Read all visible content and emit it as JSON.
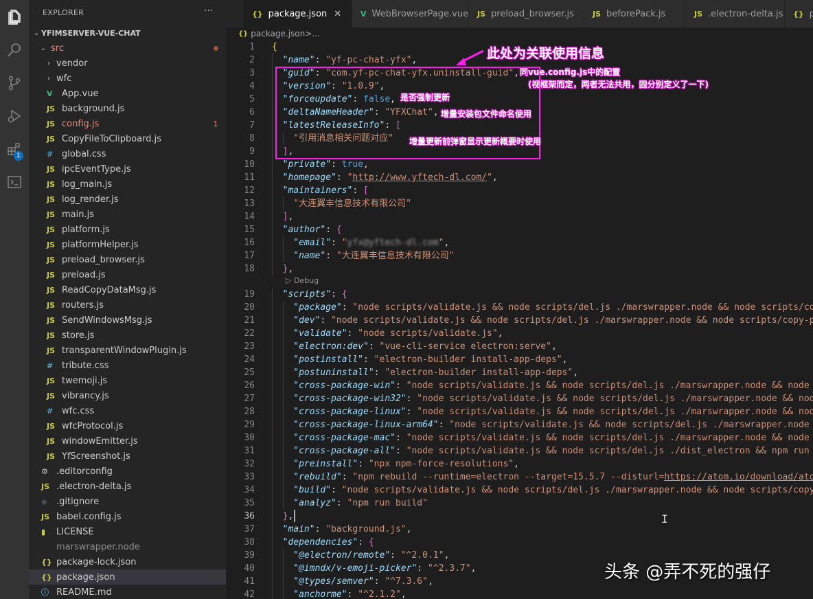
{
  "activity_bar": {
    "extensions_badge": "1"
  },
  "explorer": {
    "title": "EXPLORER",
    "more": "···",
    "root_folder": "YFIMSERVER-VUE-CHAT",
    "items": [
      {
        "name": "src",
        "kind": "folder-open",
        "indent": 1,
        "icon": "",
        "color": "#f48771",
        "dot": true
      },
      {
        "name": "vendor",
        "kind": "folder",
        "indent": 2,
        "icon": "",
        "color": "#cccccc"
      },
      {
        "name": "wfc",
        "kind": "folder",
        "indent": 2,
        "icon": "",
        "color": "#cccccc"
      },
      {
        "name": "App.vue",
        "kind": "file",
        "indent": 2,
        "icon": "V",
        "icon_color": "#41b883",
        "color": "#cccccc"
      },
      {
        "name": "background.js",
        "kind": "file",
        "indent": 2,
        "icon": "JS",
        "icon_color": "#cbcb41",
        "color": "#cccccc"
      },
      {
        "name": "config.js",
        "kind": "file",
        "indent": 2,
        "icon": "JS",
        "icon_color": "#cbcb41",
        "color": "#f48771",
        "count": "1"
      },
      {
        "name": "CopyFileToClipboard.js",
        "kind": "file",
        "indent": 2,
        "icon": "JS",
        "icon_color": "#cbcb41",
        "color": "#cccccc"
      },
      {
        "name": "global.css",
        "kind": "file",
        "indent": 2,
        "icon": "#",
        "icon_color": "#519aba",
        "color": "#cccccc"
      },
      {
        "name": "ipcEventType.js",
        "kind": "file",
        "indent": 2,
        "icon": "JS",
        "icon_color": "#cbcb41",
        "color": "#cccccc"
      },
      {
        "name": "log_main.js",
        "kind": "file",
        "indent": 2,
        "icon": "JS",
        "icon_color": "#cbcb41",
        "color": "#cccccc"
      },
      {
        "name": "log_render.js",
        "kind": "file",
        "indent": 2,
        "icon": "JS",
        "icon_color": "#cbcb41",
        "color": "#cccccc"
      },
      {
        "name": "main.js",
        "kind": "file",
        "indent": 2,
        "icon": "JS",
        "icon_color": "#cbcb41",
        "color": "#cccccc"
      },
      {
        "name": "platform.js",
        "kind": "file",
        "indent": 2,
        "icon": "JS",
        "icon_color": "#cbcb41",
        "color": "#cccccc"
      },
      {
        "name": "platformHelper.js",
        "kind": "file",
        "indent": 2,
        "icon": "JS",
        "icon_color": "#cbcb41",
        "color": "#cccccc"
      },
      {
        "name": "preload_browser.js",
        "kind": "file",
        "indent": 2,
        "icon": "JS",
        "icon_color": "#cbcb41",
        "color": "#cccccc"
      },
      {
        "name": "preload.js",
        "kind": "file",
        "indent": 2,
        "icon": "JS",
        "icon_color": "#cbcb41",
        "color": "#cccccc"
      },
      {
        "name": "ReadCopyDataMsg.js",
        "kind": "file",
        "indent": 2,
        "icon": "JS",
        "icon_color": "#cbcb41",
        "color": "#cccccc"
      },
      {
        "name": "routers.js",
        "kind": "file",
        "indent": 2,
        "icon": "JS",
        "icon_color": "#cbcb41",
        "color": "#cccccc"
      },
      {
        "name": "SendWindowsMsg.js",
        "kind": "file",
        "indent": 2,
        "icon": "JS",
        "icon_color": "#cbcb41",
        "color": "#cccccc"
      },
      {
        "name": "store.js",
        "kind": "file",
        "indent": 2,
        "icon": "JS",
        "icon_color": "#cbcb41",
        "color": "#cccccc"
      },
      {
        "name": "transparentWindowPlugin.js",
        "kind": "file",
        "indent": 2,
        "icon": "JS",
        "icon_color": "#cbcb41",
        "color": "#cccccc"
      },
      {
        "name": "tribute.css",
        "kind": "file",
        "indent": 2,
        "icon": "#",
        "icon_color": "#519aba",
        "color": "#cccccc"
      },
      {
        "name": "twemoji.js",
        "kind": "file",
        "indent": 2,
        "icon": "JS",
        "icon_color": "#cbcb41",
        "color": "#cccccc"
      },
      {
        "name": "vibrancy.js",
        "kind": "file",
        "indent": 2,
        "icon": "JS",
        "icon_color": "#cbcb41",
        "color": "#cccccc"
      },
      {
        "name": "wfc.css",
        "kind": "file",
        "indent": 2,
        "icon": "#",
        "icon_color": "#519aba",
        "color": "#cccccc"
      },
      {
        "name": "wfcProtocol.js",
        "kind": "file",
        "indent": 2,
        "icon": "JS",
        "icon_color": "#cbcb41",
        "color": "#cccccc"
      },
      {
        "name": "windowEmitter.js",
        "kind": "file",
        "indent": 2,
        "icon": "JS",
        "icon_color": "#cbcb41",
        "color": "#cccccc"
      },
      {
        "name": "YfScreenshot.js",
        "kind": "file",
        "indent": 2,
        "icon": "JS",
        "icon_color": "#cbcb41",
        "color": "#cccccc"
      },
      {
        "name": ".editorconfig",
        "kind": "file",
        "indent": 1,
        "icon": "⚙",
        "icon_color": "#cccccc",
        "color": "#cccccc"
      },
      {
        "name": ".electron-delta.js",
        "kind": "file",
        "indent": 1,
        "icon": "JS",
        "icon_color": "#cbcb41",
        "color": "#cccccc"
      },
      {
        "name": ".gitignore",
        "kind": "file",
        "indent": 1,
        "icon": "◆",
        "icon_color": "#41535b",
        "color": "#cccccc"
      },
      {
        "name": "babel.config.js",
        "kind": "file",
        "indent": 1,
        "icon": "JS",
        "icon_color": "#cbcb41",
        "color": "#cccccc"
      },
      {
        "name": "LICENSE",
        "kind": "file",
        "indent": 1,
        "icon": "▮",
        "icon_color": "#cbcb41",
        "color": "#cccccc"
      },
      {
        "name": "marswrapper.node",
        "kind": "file",
        "indent": 1,
        "icon": "",
        "icon_color": "#cccccc",
        "color": "#8c8c8c"
      },
      {
        "name": "package-lock.json",
        "kind": "file",
        "indent": 1,
        "icon": "{}",
        "icon_color": "#cbcb41",
        "color": "#cccccc"
      },
      {
        "name": "package.json",
        "kind": "file",
        "indent": 1,
        "icon": "{}",
        "icon_color": "#cbcb41",
        "color": "#cccccc",
        "active": true
      },
      {
        "name": "README.md",
        "kind": "file",
        "indent": 1,
        "icon": "ⓘ",
        "icon_color": "#519aba",
        "color": "#cccccc"
      }
    ]
  },
  "tabs": [
    {
      "label": "package.json",
      "icon": "{}",
      "icon_color": "#cbcb41",
      "active": true,
      "close": "✕"
    },
    {
      "label": "WebBrowserPage.vue",
      "icon": "V",
      "icon_color": "#41b883"
    },
    {
      "label": "preload_browser.js",
      "icon": "JS",
      "icon_color": "#cbcb41"
    },
    {
      "label": "beforePack.js",
      "icon": "JS",
      "icon_color": "#cbcb41"
    },
    {
      "label": ".electron-delta.js",
      "icon": "JS",
      "icon_color": "#cbcb41"
    },
    {
      "label": "pac",
      "icon": "{}",
      "icon_color": "#cbcb41"
    }
  ],
  "breadcrumb": {
    "icon": "{}",
    "file": "package.json",
    "sep": " > ",
    "tail": "..."
  },
  "codelens": "▷ Debug",
  "code_lines": [
    {
      "n": "1",
      "ind": 0,
      "t": [
        [
          "br1",
          "{"
        ]
      ]
    },
    {
      "n": "2",
      "ind": 1,
      "t": [
        [
          "k",
          "\"name\""
        ],
        [
          "p",
          ": "
        ],
        [
          "s",
          "\"yf-pc-chat-yfx\""
        ],
        [
          "p",
          ","
        ]
      ]
    },
    {
      "n": "3",
      "ind": 1,
      "t": [
        [
          "k",
          "\"guid\""
        ],
        [
          "p",
          ": "
        ],
        [
          "s",
          "\"com.yf-pc-chat-yfx.uninstall-guid\""
        ],
        [
          "p",
          ","
        ]
      ]
    },
    {
      "n": "4",
      "ind": 1,
      "t": [
        [
          "k",
          "\"version\""
        ],
        [
          "p",
          ": "
        ],
        [
          "s",
          "\"1.0.9\""
        ],
        [
          "p",
          ","
        ]
      ]
    },
    {
      "n": "5",
      "ind": 1,
      "t": [
        [
          "k",
          "\"forceupdate\""
        ],
        [
          "p",
          ": "
        ],
        [
          "b",
          "false"
        ],
        [
          "p",
          ","
        ]
      ]
    },
    {
      "n": "6",
      "ind": 1,
      "t": [
        [
          "k",
          "\"deltaNameHeader\""
        ],
        [
          "p",
          ": "
        ],
        [
          "s",
          "\"YFXChat\""
        ],
        [
          "p",
          ","
        ]
      ]
    },
    {
      "n": "7",
      "ind": 1,
      "t": [
        [
          "k",
          "\"latestReleaseInfo\""
        ],
        [
          "p",
          ": "
        ],
        [
          "br2",
          "["
        ]
      ]
    },
    {
      "n": "8",
      "ind": 2,
      "t": [
        [
          "s",
          "\"引用消息相关问题对应\""
        ]
      ]
    },
    {
      "n": "9",
      "ind": 1,
      "t": [
        [
          "br2",
          "]"
        ],
        [
          "p",
          ","
        ]
      ]
    },
    {
      "n": "10",
      "ind": 1,
      "t": [
        [
          "k",
          "\"private\""
        ],
        [
          "p",
          ": "
        ],
        [
          "b",
          "true"
        ],
        [
          "p",
          ","
        ]
      ]
    },
    {
      "n": "11",
      "ind": 1,
      "t": [
        [
          "k",
          "\"homepage\""
        ],
        [
          "p",
          ": "
        ],
        [
          "s",
          "\""
        ],
        [
          "su",
          "http://www.yftech-dl.com/"
        ],
        [
          "s",
          "\""
        ],
        [
          "p",
          ","
        ]
      ]
    },
    {
      "n": "12",
      "ind": 1,
      "t": [
        [
          "k",
          "\"maintainers\""
        ],
        [
          "p",
          ": "
        ],
        [
          "br2",
          "["
        ]
      ]
    },
    {
      "n": "13",
      "ind": 2,
      "t": [
        [
          "s",
          "\"大连翼丰信息技术有限公司\""
        ]
      ]
    },
    {
      "n": "14",
      "ind": 1,
      "t": [
        [
          "br2",
          "]"
        ],
        [
          "p",
          ","
        ]
      ]
    },
    {
      "n": "15",
      "ind": 1,
      "t": [
        [
          "k",
          "\"author\""
        ],
        [
          "p",
          ": "
        ],
        [
          "br2",
          "{"
        ]
      ]
    },
    {
      "n": "16",
      "ind": 2,
      "t": [
        [
          "k",
          "\"email\""
        ],
        [
          "p",
          ": "
        ],
        [
          "s",
          "\""
        ],
        [
          "blur",
          "yfx@yftech-dl.com"
        ],
        [
          "s",
          "\""
        ],
        [
          "p",
          ","
        ]
      ]
    },
    {
      "n": "17",
      "ind": 2,
      "t": [
        [
          "k",
          "\"name\""
        ],
        [
          "p",
          ": "
        ],
        [
          "s",
          "\"大连翼丰信息技术有限公司\""
        ]
      ]
    },
    {
      "n": "18",
      "ind": 1,
      "t": [
        [
          "br2",
          "}"
        ],
        [
          "p",
          ","
        ]
      ]
    },
    {
      "n": "19",
      "ind": 1,
      "t": [
        [
          "k",
          "\"scripts\""
        ],
        [
          "p",
          ": "
        ],
        [
          "br2",
          "{"
        ]
      ]
    },
    {
      "n": "20",
      "ind": 2,
      "t": [
        [
          "k",
          "\"package\""
        ],
        [
          "p",
          ": "
        ],
        [
          "s",
          "\"node scripts/validate.js && node scripts/del.js ./marswrapper.node && node scripts/copy-"
        ]
      ]
    },
    {
      "n": "21",
      "ind": 2,
      "t": [
        [
          "k",
          "\"dev\""
        ],
        [
          "p",
          ": "
        ],
        [
          "s",
          "\"node scripts/validate.js && node scripts/del.js ./marswrapper.node && node scripts/copy-pre"
        ]
      ]
    },
    {
      "n": "22",
      "ind": 2,
      "t": [
        [
          "k",
          "\"validate\""
        ],
        [
          "p",
          ": "
        ],
        [
          "s",
          "\"node scripts/validate.js\""
        ],
        [
          "p",
          ","
        ]
      ]
    },
    {
      "n": "23",
      "ind": 2,
      "t": [
        [
          "k",
          "\"electron:dev\""
        ],
        [
          "p",
          ": "
        ],
        [
          "s",
          "\"vue-cli-service electron:serve\""
        ],
        [
          "p",
          ","
        ]
      ]
    },
    {
      "n": "24",
      "ind": 2,
      "t": [
        [
          "k",
          "\"postinstall\""
        ],
        [
          "p",
          ": "
        ],
        [
          "s",
          "\"electron-builder install-app-deps\""
        ],
        [
          "p",
          ","
        ]
      ]
    },
    {
      "n": "25",
      "ind": 2,
      "t": [
        [
          "k",
          "\"postuninstall\""
        ],
        [
          "p",
          ": "
        ],
        [
          "s",
          "\"electron-builder install-app-deps\""
        ],
        [
          "p",
          ","
        ]
      ]
    },
    {
      "n": "26",
      "ind": 2,
      "t": [
        [
          "k",
          "\"cross-package-win\""
        ],
        [
          "p",
          ": "
        ],
        [
          "s",
          "\"node scripts/validate.js && node scripts/del.js ./marswrapper.node && node sc"
        ]
      ]
    },
    {
      "n": "27",
      "ind": 2,
      "t": [
        [
          "k",
          "\"cross-package-win32\""
        ],
        [
          "p",
          ": "
        ],
        [
          "s",
          "\"node scripts/validate.js && node scripts/del.js ./marswrapper.node && node"
        ]
      ]
    },
    {
      "n": "28",
      "ind": 2,
      "t": [
        [
          "k",
          "\"cross-package-linux\""
        ],
        [
          "p",
          ": "
        ],
        [
          "s",
          "\"node scripts/validate.js && node scripts/del.js ./marswrapper.node && node"
        ]
      ]
    },
    {
      "n": "29",
      "ind": 2,
      "t": [
        [
          "k",
          "\"cross-package-linux-arm64\""
        ],
        [
          "p",
          ": "
        ],
        [
          "s",
          "\"node scripts/validate.js && node scripts/del.js ./marswrapper.node &&"
        ]
      ]
    },
    {
      "n": "30",
      "ind": 2,
      "t": [
        [
          "k",
          "\"cross-package-mac\""
        ],
        [
          "p",
          ": "
        ],
        [
          "s",
          "\"node scripts/validate.js && node scripts/del.js ./marswrapper.node && node sc"
        ]
      ]
    },
    {
      "n": "31",
      "ind": 2,
      "t": [
        [
          "k",
          "\"cross-package-all\""
        ],
        [
          "p",
          ": "
        ],
        [
          "s",
          "\"node scripts/validate.js && node scripts/del.js ./dist_electron && npm run cr"
        ]
      ]
    },
    {
      "n": "32",
      "ind": 2,
      "t": [
        [
          "k",
          "\"preinstall\""
        ],
        [
          "p",
          ": "
        ],
        [
          "s",
          "\"npx npm-force-resolutions\""
        ],
        [
          "p",
          ","
        ]
      ]
    },
    {
      "n": "33",
      "ind": 2,
      "t": [
        [
          "k",
          "\"rebuild\""
        ],
        [
          "p",
          ": "
        ],
        [
          "s",
          "\"npm rebuild --runtime=electron --target=15.5.7 --disturl="
        ],
        [
          "su",
          "https://atom.io/download/atom-"
        ]
      ]
    },
    {
      "n": "34",
      "ind": 2,
      "t": [
        [
          "k",
          "\"build\""
        ],
        [
          "p",
          ": "
        ],
        [
          "s",
          "\"node scripts/validate.js && node scripts/del.js ./marswrapper.node && node scripts/copy-p"
        ]
      ]
    },
    {
      "n": "35",
      "ind": 2,
      "t": [
        [
          "k",
          "\"analyz\""
        ],
        [
          "p",
          ": "
        ],
        [
          "s",
          "\"npm run build\""
        ]
      ]
    },
    {
      "n": "36",
      "ind": 1,
      "t": [
        [
          "br2",
          "}"
        ],
        [
          "p",
          ","
        ]
      ],
      "current": true
    },
    {
      "n": "37",
      "ind": 1,
      "t": [
        [
          "k",
          "\"main\""
        ],
        [
          "p",
          ": "
        ],
        [
          "s",
          "\"background.js\""
        ],
        [
          "p",
          ","
        ]
      ]
    },
    {
      "n": "38",
      "ind": 1,
      "t": [
        [
          "k",
          "\"dependencies\""
        ],
        [
          "p",
          ": "
        ],
        [
          "br2",
          "{"
        ]
      ]
    },
    {
      "n": "39",
      "ind": 2,
      "t": [
        [
          "k",
          "\"@electron/remote\""
        ],
        [
          "p",
          ": "
        ],
        [
          "s",
          "\"^2.0.1\""
        ],
        [
          "p",
          ","
        ]
      ]
    },
    {
      "n": "40",
      "ind": 2,
      "t": [
        [
          "k",
          "\"@imndx/v-emoji-picker\""
        ],
        [
          "p",
          ": "
        ],
        [
          "s",
          "\"^2.3.7\""
        ],
        [
          "p",
          ","
        ]
      ]
    },
    {
      "n": "41",
      "ind": 2,
      "t": [
        [
          "k",
          "\"@types/semver\""
        ],
        [
          "p",
          ": "
        ],
        [
          "s",
          "\"^7.3.6\""
        ],
        [
          "p",
          ","
        ]
      ]
    },
    {
      "n": "42",
      "ind": 2,
      "t": [
        [
          "k",
          "\"anchorme\""
        ],
        [
          "p",
          ": "
        ],
        [
          "s",
          "\"^2.1.2\""
        ],
        [
          "p",
          ","
        ]
      ]
    }
  ],
  "annotations": {
    "title": "此处为关联使用信息",
    "guid_note_1": "同vue.config.js中的配置",
    "guid_note_2": "(视框架而定，两者无法共用，固分别定义了一下)",
    "force_note": "是否强制更新",
    "delta_note": "增量安装包文件命名使用",
    "release_note": "增量更新前弹窗显示更新概要时使用"
  },
  "watermark": "头条 @弄不死的强仔",
  "colors": {
    "accent_annotation": "#ff1cf0",
    "editor_bg": "#1e1e1e",
    "sidebar_bg": "#252526",
    "activity_bg": "#333333"
  }
}
